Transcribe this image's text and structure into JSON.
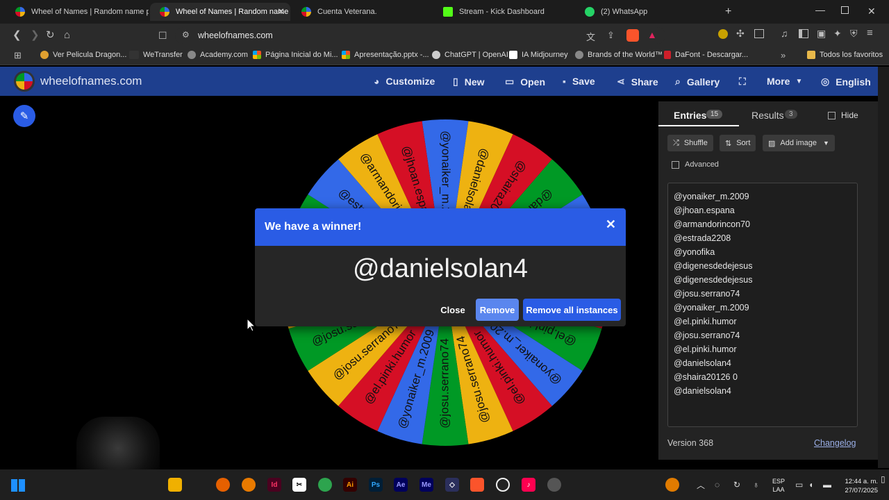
{
  "browser": {
    "tabs": [
      {
        "label": "Wheel of Names | Random name pic",
        "color": "#3b6fe0"
      },
      {
        "label": "Wheel of Names | Random name",
        "color": "#3b6fe0"
      },
      {
        "label": "Cuenta Veterana.",
        "color": "#3b6fe0"
      },
      {
        "label": "Stream - Kick Dashboard",
        "color": "#53fc18"
      },
      {
        "label": "(2) WhatsApp",
        "color": "#25d366"
      }
    ],
    "url": "wheelofnames.com",
    "bookmarks": [
      "Ver Pelicula Dragon...",
      "WeTransfer",
      "Academy.com",
      "Página Inicial do Mi...",
      "Apresentação.pptx -...",
      "ChatGPT | OpenAI",
      "IA Midjourney",
      "Brands of the World™",
      "DaFont - Descargar..."
    ],
    "bookmarks_all": "Todos los favoritos"
  },
  "site": {
    "logo_text": "wheelofnames.com",
    "nav": {
      "customize": "Customize",
      "new": "New",
      "open": "Open",
      "save": "Save",
      "share": "Share",
      "gallery": "Gallery",
      "more": "More",
      "language": "English"
    }
  },
  "wheel": {
    "segments": [
      {
        "label": "@yonaiker_m.2009",
        "color": "#3369e8"
      },
      {
        "label": "@danielsolan4",
        "color": "#eeb211"
      },
      {
        "label": "@shaira20126 0",
        "color": "#d50f25"
      },
      {
        "label": "@danielsolan4",
        "color": "#009925"
      },
      {
        "label": "@yonaiker_m.2009",
        "color": "#3369e8"
      },
      {
        "label": "@el.pinki.humor",
        "color": "#eeb211"
      },
      {
        "label": "@josu.serrano74",
        "color": "#d50f25"
      },
      {
        "label": "@el.pinki.humor",
        "color": "#009925"
      },
      {
        "label": "@yonaiker_m.2009",
        "color": "#3369e8"
      },
      {
        "label": "@el.pinki.humor",
        "color": "#d50f25"
      },
      {
        "label": "@josu.serrano74",
        "color": "#eeb211"
      },
      {
        "label": "@josu.serrano74",
        "color": "#009925"
      },
      {
        "label": "@yonaiker_m.2009",
        "color": "#3369e8"
      },
      {
        "label": "@el.pinki.humor",
        "color": "#d50f25"
      },
      {
        "label": "@josu.serrano74",
        "color": "#eeb211"
      },
      {
        "label": "@josu.serrano74",
        "color": "#009925"
      },
      {
        "label": "@digenesdedejesus",
        "color": "#eeb211"
      },
      {
        "label": "@digenesdedejesus",
        "color": "#d50f25"
      },
      {
        "label": "@yonofika",
        "color": "#009925"
      },
      {
        "label": "@estrada2208",
        "color": "#3369e8"
      },
      {
        "label": "@armandorincon70",
        "color": "#eeb211"
      },
      {
        "label": "@jhoan.espana",
        "color": "#d50f25"
      }
    ]
  },
  "panel": {
    "tab_entries": "Entries",
    "entries_count": "15",
    "tab_results": "Results",
    "results_count": "3",
    "hide": "Hide",
    "shuffle": "Shuffle",
    "sort": "Sort",
    "add_image": "Add image",
    "advanced": "Advanced",
    "entries": [
      "@yonaiker_m.2009",
      "@jhoan.espana",
      "@armandorincon70",
      "@estrada2208",
      "@yonofika",
      "@digenesdedejesus",
      "@digenesdedejesus",
      "@josu.serrano74",
      "@yonaiker_m.2009",
      "@el.pinki.humor",
      "@josu.serrano74",
      "@el.pinki.humor",
      "@danielsolan4",
      "@shaira20126 0",
      "@danielsolan4"
    ],
    "version": "Version 368",
    "changelog": "Changelog"
  },
  "dialog": {
    "title": "We have a winner!",
    "winner": "@danielsolan4",
    "close": "Close",
    "remove": "Remove",
    "remove_all": "Remove all instances"
  },
  "taskbar": {
    "lang_top": "ESP",
    "lang_bottom": "LAA",
    "time": "12:44 a. m.",
    "date": "27/07/2025",
    "apps": [
      "Id",
      "Ai",
      "Ps",
      "Ae",
      "Me"
    ]
  }
}
